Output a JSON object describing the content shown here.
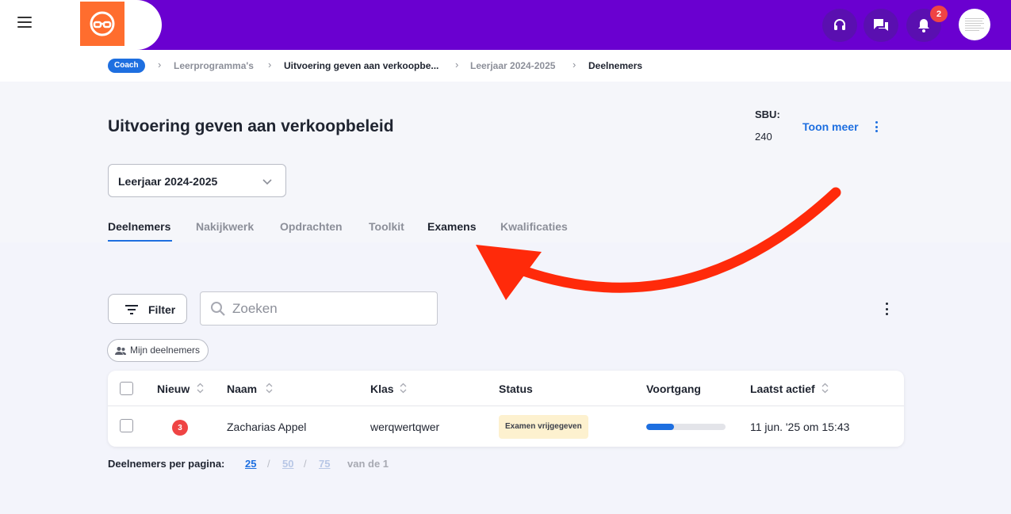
{
  "topbar": {
    "notifications_count": "2",
    "colors": {
      "bar": "#6a00d0",
      "logo": "#ff6d2e"
    },
    "icons": [
      "menu-icon",
      "logo-icon",
      "headset-icon",
      "chat-icon",
      "bell-icon",
      "avatar"
    ]
  },
  "breadcrumb": {
    "badge": "Coach",
    "items": [
      "Leerprogramma's",
      "Uitvoering geven aan verkoopbe...",
      "Leerjaar 2024-2025",
      "Deelnemers"
    ]
  },
  "header": {
    "title": "Uitvoering geven aan verkoopbeleid",
    "sbu_label": "SBU:",
    "sbu_value": "240",
    "toon_meer": "Toon meer",
    "year_select": "Leerjaar 2024-2025"
  },
  "tabs": [
    "Deelnemers",
    "Nakijkwerk",
    "Opdrachten",
    "Toolkit",
    "Examens",
    "Kwalificaties"
  ],
  "toolbar": {
    "filter_label": "Filter",
    "search_placeholder": "Zoeken",
    "chip_label": "Mijn deelnemers"
  },
  "table": {
    "columns": [
      "Nieuw",
      "Naam",
      "Klas",
      "Status",
      "Voortgang",
      "Laatst actief"
    ],
    "rows": [
      {
        "new_count": "3",
        "name": "Zacharias Appel",
        "klas": "werqwertqwer",
        "status": "Examen vrijgegeven",
        "progress": 0.35,
        "last_active": "11 jun. '25 om 15:43"
      }
    ]
  },
  "pagination": {
    "label": "Deelnemers per pagina:",
    "options": [
      "25",
      "50",
      "75"
    ],
    "total": "van de 1"
  }
}
